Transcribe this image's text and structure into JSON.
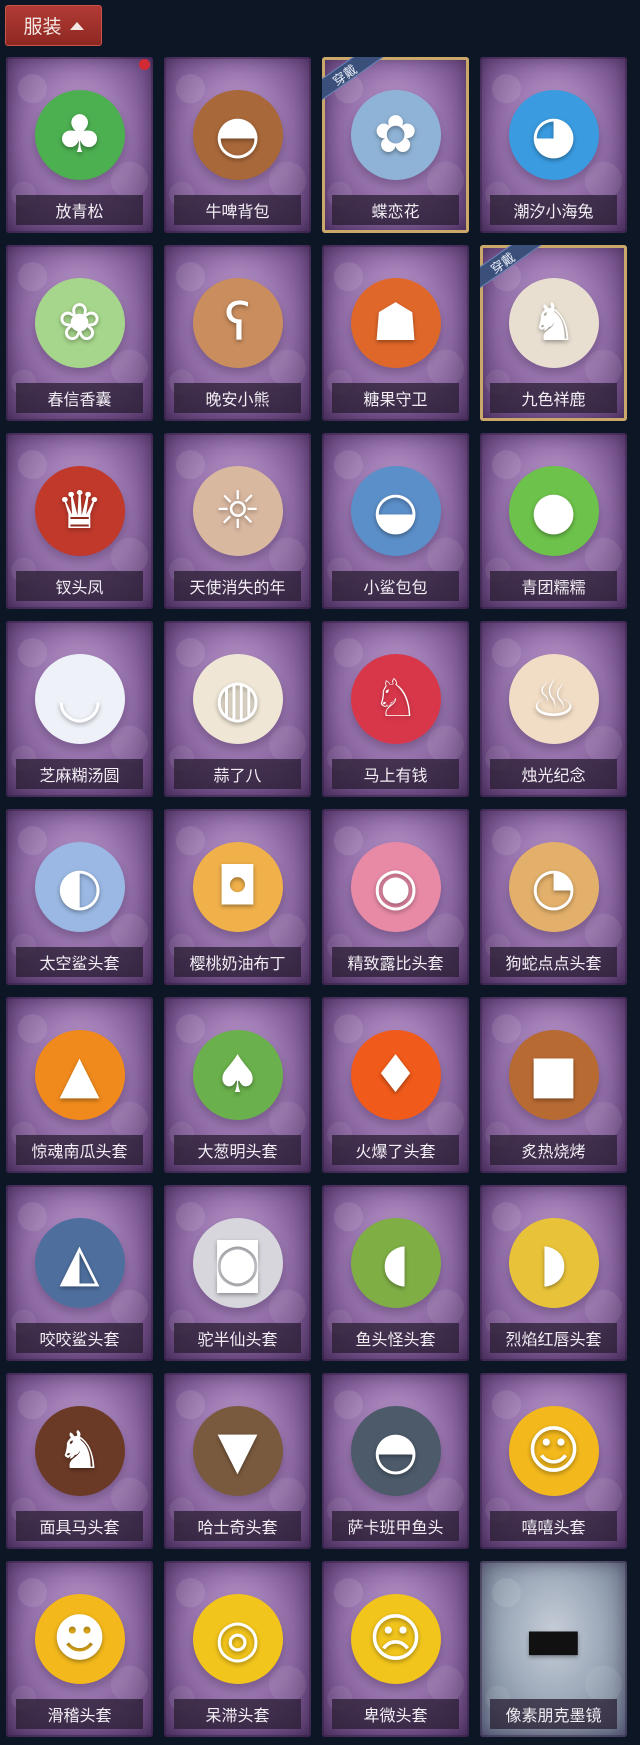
{
  "header": {
    "title": "服装"
  },
  "items": [
    {
      "name": "放青松",
      "worn": false,
      "new_dot": true,
      "icon": "tree-icon",
      "glyph": "♣",
      "color": "#4caf50",
      "gray": false
    },
    {
      "name": "牛啤背包",
      "worn": false,
      "new_dot": false,
      "icon": "barrel-icon",
      "glyph": "◓",
      "color": "#a8683a",
      "gray": false
    },
    {
      "name": "蝶恋花",
      "worn": true,
      "worn_label": "穿戴",
      "new_dot": false,
      "icon": "wreath-icon",
      "glyph": "✿",
      "color": "#8fb3d6",
      "gray": false
    },
    {
      "name": "潮汐小海兔",
      "worn": false,
      "new_dot": false,
      "icon": "sea-bunny-icon",
      "glyph": "◕",
      "color": "#3a9be0",
      "gray": false
    },
    {
      "name": "春信香囊",
      "worn": false,
      "new_dot": false,
      "icon": "sachet-icon",
      "glyph": "❀",
      "color": "#a6d68c",
      "gray": false
    },
    {
      "name": "晚安小熊",
      "worn": false,
      "new_dot": false,
      "icon": "bear-icon",
      "glyph": "ʕ",
      "color": "#c98d5e",
      "gray": false
    },
    {
      "name": "糖果守卫",
      "worn": false,
      "new_dot": false,
      "icon": "pumpkin-guard-icon",
      "glyph": "☗",
      "color": "#e0672a",
      "gray": false
    },
    {
      "name": "九色祥鹿",
      "worn": true,
      "worn_label": "穿戴",
      "new_dot": false,
      "icon": "deer-icon",
      "glyph": "♞",
      "color": "#e8dfd1",
      "gray": false
    },
    {
      "name": "钗头凤",
      "worn": false,
      "new_dot": false,
      "icon": "phoenix-crown-icon",
      "glyph": "♛",
      "color": "#c0392b",
      "gray": false
    },
    {
      "name": "天使消失的年",
      "worn": false,
      "new_dot": false,
      "icon": "angel-girl-icon",
      "glyph": "☼",
      "color": "#d9b8a0",
      "gray": false
    },
    {
      "name": "小鲨包包",
      "worn": false,
      "new_dot": false,
      "icon": "shark-bag-icon",
      "glyph": "◒",
      "color": "#5b8fc9",
      "gray": false
    },
    {
      "name": "青团糯糯",
      "worn": false,
      "new_dot": false,
      "icon": "green-dumpling-icon",
      "glyph": "●",
      "color": "#6cc24a",
      "gray": false
    },
    {
      "name": "芝麻糊汤圆",
      "worn": false,
      "new_dot": false,
      "icon": "rice-ball-icon",
      "glyph": "◡",
      "color": "#eef1f8",
      "gray": false
    },
    {
      "name": "蒜了八",
      "worn": false,
      "new_dot": false,
      "icon": "garlic-icon",
      "glyph": "◍",
      "color": "#efe6d5",
      "gray": false
    },
    {
      "name": "马上有钱",
      "worn": false,
      "new_dot": false,
      "icon": "red-horse-icon",
      "glyph": "♘",
      "color": "#d8374a",
      "gray": false
    },
    {
      "name": "烛光纪念",
      "worn": false,
      "new_dot": false,
      "icon": "candle-icon",
      "glyph": "♨",
      "color": "#f1dcc5",
      "gray": false
    },
    {
      "name": "太空鲨头套",
      "worn": false,
      "new_dot": false,
      "icon": "space-shark-icon",
      "glyph": "◐",
      "color": "#9ab8e3",
      "gray": false
    },
    {
      "name": "樱桃奶油布丁",
      "worn": false,
      "new_dot": false,
      "icon": "pudding-icon",
      "glyph": "◘",
      "color": "#f0b04a",
      "gray": false
    },
    {
      "name": "精致露比头套",
      "worn": false,
      "new_dot": false,
      "icon": "pink-beaver-icon",
      "glyph": "◉",
      "color": "#e88aa6",
      "gray": false
    },
    {
      "name": "狗蛇点点头套",
      "worn": false,
      "new_dot": false,
      "icon": "dog-snake-icon",
      "glyph": "◔",
      "color": "#e3b06b",
      "gray": false
    },
    {
      "name": "惊魂南瓜头套",
      "worn": false,
      "new_dot": false,
      "icon": "jack-o-lantern-icon",
      "glyph": "▲",
      "color": "#f08a1c",
      "gray": false
    },
    {
      "name": "大葱明头套",
      "worn": false,
      "new_dot": false,
      "icon": "scallion-icon",
      "glyph": "♠",
      "color": "#6ab04c",
      "gray": false
    },
    {
      "name": "火爆了头套",
      "worn": false,
      "new_dot": false,
      "icon": "fire-icon",
      "glyph": "♦",
      "color": "#f05a1a",
      "gray": false
    },
    {
      "name": "炙热烧烤",
      "worn": false,
      "new_dot": false,
      "icon": "bbq-meat-icon",
      "glyph": "■",
      "color": "#b86a33",
      "gray": false
    },
    {
      "name": "咬咬鲨头套",
      "worn": false,
      "new_dot": false,
      "icon": "biting-shark-icon",
      "glyph": "◭",
      "color": "#4e6f9e",
      "gray": false
    },
    {
      "name": "驼半仙头套",
      "worn": false,
      "new_dot": false,
      "icon": "alpaca-sunglasses-icon",
      "glyph": "◙",
      "color": "#d6d6dc",
      "gray": false
    },
    {
      "name": "鱼头怪头套",
      "worn": false,
      "new_dot": false,
      "icon": "fish-head-icon",
      "glyph": "◖",
      "color": "#7fae45",
      "gray": false
    },
    {
      "name": "烈焰红唇头套",
      "worn": false,
      "new_dot": false,
      "icon": "yellow-mask-icon",
      "glyph": "◗",
      "color": "#e8c33a",
      "gray": false
    },
    {
      "name": "面具马头套",
      "worn": false,
      "new_dot": false,
      "icon": "horse-mask-icon",
      "glyph": "♞",
      "color": "#6b3a26",
      "gray": false
    },
    {
      "name": "哈士奇头套",
      "worn": false,
      "new_dot": false,
      "icon": "husky-icon",
      "glyph": "▼",
      "color": "#7a5a3e",
      "gray": false
    },
    {
      "name": "萨卡班甲鱼头",
      "worn": false,
      "new_dot": false,
      "icon": "sacabambaspis-icon",
      "glyph": "◓",
      "color": "#4c5a6a",
      "gray": false
    },
    {
      "name": "嘻嘻头套",
      "worn": false,
      "new_dot": false,
      "icon": "grin-emoji-icon",
      "glyph": "☺",
      "color": "#f2b81c",
      "gray": false
    },
    {
      "name": "滑稽头套",
      "worn": false,
      "new_dot": false,
      "icon": "smirk-emoji-icon",
      "glyph": "☻",
      "color": "#f2b81c",
      "gray": false
    },
    {
      "name": "呆滞头套",
      "worn": false,
      "new_dot": false,
      "icon": "stare-emoji-icon",
      "glyph": "◎",
      "color": "#f2c51c",
      "gray": false
    },
    {
      "name": "卑微头套",
      "worn": false,
      "new_dot": false,
      "icon": "humble-emoji-icon",
      "glyph": "☹",
      "color": "#f2c51c",
      "gray": false
    },
    {
      "name": "像素朋克墨镜",
      "worn": false,
      "new_dot": false,
      "icon": "pixel-sunglasses-icon",
      "glyph": "▬",
      "color": "#111111",
      "gray": true
    }
  ]
}
